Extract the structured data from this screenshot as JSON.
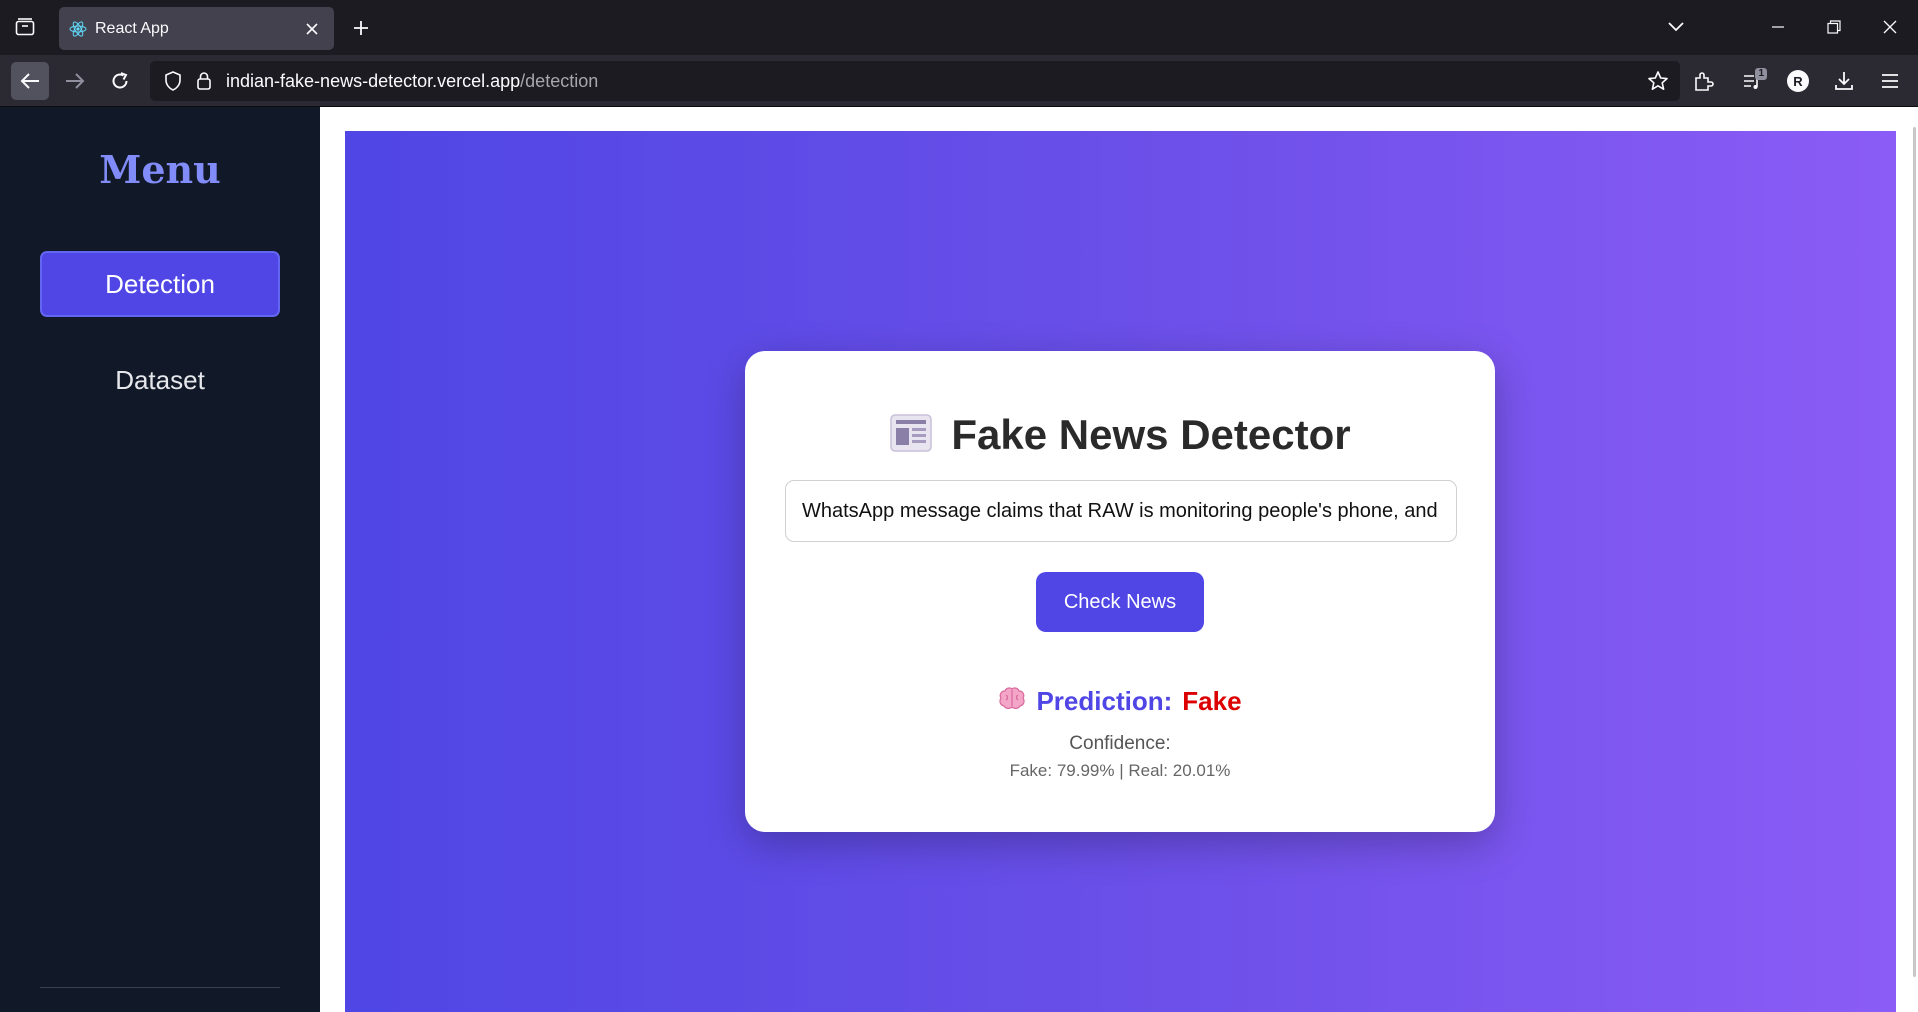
{
  "browser": {
    "tab": {
      "title": "React App"
    },
    "url": {
      "host": "indian-fake-news-detector.vercel.app",
      "path": "/detection"
    },
    "downloads_badge": "1",
    "profile_initial": "R"
  },
  "sidebar": {
    "title": "Menu",
    "items": [
      {
        "label": "Detection",
        "active": true
      },
      {
        "label": "Dataset",
        "active": false
      }
    ]
  },
  "detector": {
    "icon": "newspaper-icon",
    "title": "Fake News Detector",
    "input_value": "WhatsApp message claims that RAW is monitoring people's phone, and",
    "button_label": "Check News",
    "prediction_icon": "brain-icon",
    "prediction_label": "Prediction:",
    "prediction_value": "Fake",
    "confidence_label": "Confidence:",
    "confidence_values": "Fake: 79.99% | Real: 20.01%"
  },
  "colors": {
    "accent": "#4f46e5",
    "gradient_end": "#8b5cf6",
    "sidebar_bg": "#111827",
    "fake": "#dc0000"
  }
}
